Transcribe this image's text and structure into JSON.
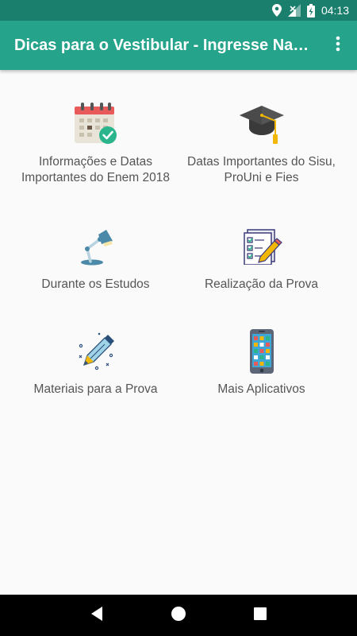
{
  "status_bar": {
    "time": "04:13",
    "icons": [
      "location-icon",
      "signal-icon",
      "battery-charging-icon"
    ]
  },
  "app_bar": {
    "title": "Dicas para o Vestibular - Ingresse Na…",
    "overflow_icon": "more-vert-icon"
  },
  "colors": {
    "status_bar": "#1b7f6e",
    "app_bar": "#26a38b",
    "background": "#fafafa",
    "label_text": "#555555",
    "nav_bar": "#000000"
  },
  "menu": {
    "items": [
      {
        "label": "Informações e Datas Importantes do Enem 2018",
        "icon": "calendar-check-icon"
      },
      {
        "label": "Datas Importantes do Sisu, ProUni e Fies",
        "icon": "graduation-cap-icon"
      },
      {
        "label": "Durante os Estudos",
        "icon": "desk-lamp-icon"
      },
      {
        "label": "Realização da Prova",
        "icon": "checklist-pencil-icon"
      },
      {
        "label": "Materiais para a Prova",
        "icon": "pen-icon"
      },
      {
        "label": "Mais Aplicativos",
        "icon": "smartphone-apps-icon"
      }
    ]
  },
  "nav_bar": {
    "buttons": [
      "back-icon",
      "home-icon",
      "recents-icon"
    ]
  }
}
